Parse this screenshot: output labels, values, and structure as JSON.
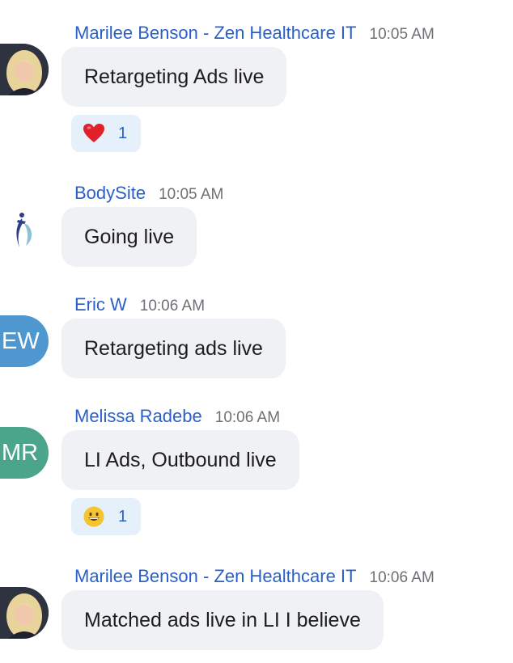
{
  "colors": {
    "sender": "#2a5fc7",
    "time": "#6f6f76",
    "bubble": "#f0f1f5",
    "reaction_bg": "#e6f0fb",
    "avatar_ew": "#4f97cf",
    "avatar_mr": "#4aa58a"
  },
  "messages": [
    {
      "sender": "Marilee Benson - Zen Healthcare IT",
      "time": "10:05 AM",
      "text": "Retargeting Ads live",
      "avatar": "photo",
      "reaction": {
        "emoji": "heart-emoji",
        "count": "1"
      }
    },
    {
      "sender": "BodySite",
      "time": "10:05 AM",
      "text": "Going live",
      "avatar": "logo"
    },
    {
      "sender": "Eric W",
      "time": "10:06 AM",
      "text": "Retargeting ads live",
      "avatar": "initials",
      "initials": "EW"
    },
    {
      "sender": "Melissa Radebe",
      "time": "10:06 AM",
      "text": "LI Ads, Outbound live",
      "avatar": "initials",
      "initials": "MR",
      "reaction": {
        "emoji": "grinning-face-emoji",
        "count": "1"
      }
    },
    {
      "sender": "Marilee Benson - Zen Healthcare IT",
      "time": "10:06 AM",
      "text": "Matched ads live in LI I believe",
      "avatar": "photo"
    }
  ]
}
